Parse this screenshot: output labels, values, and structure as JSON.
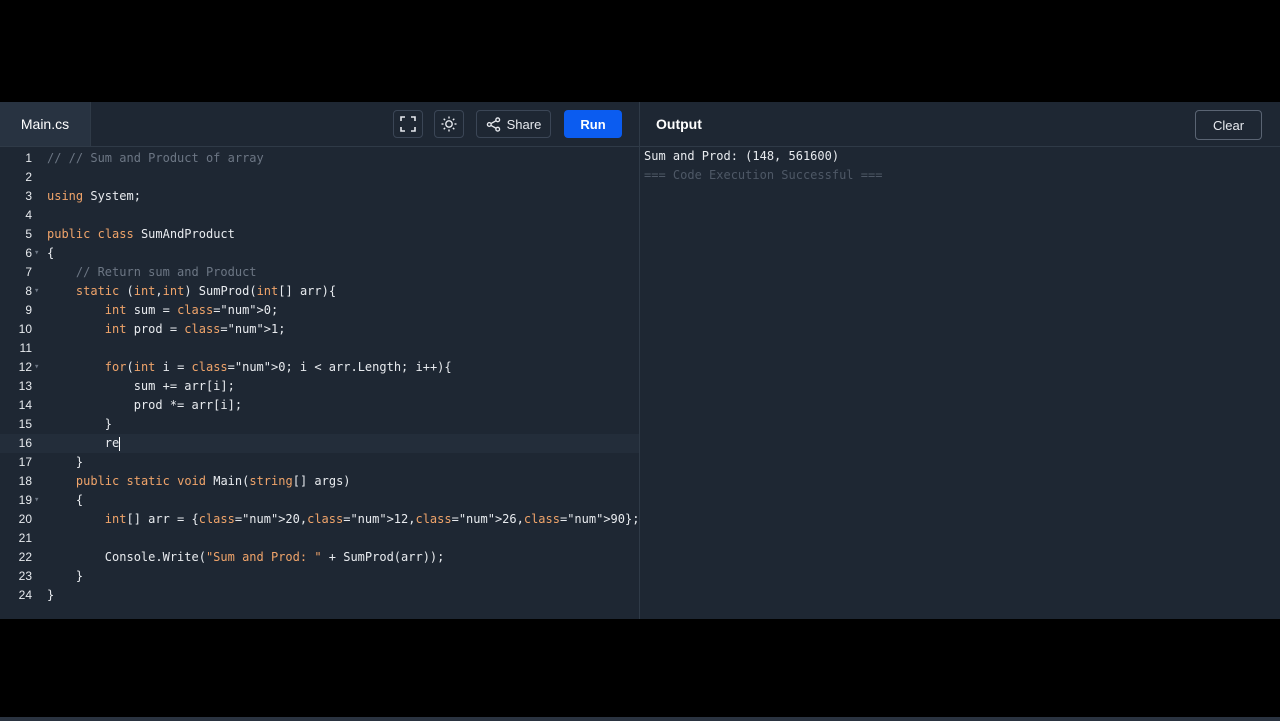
{
  "editor": {
    "file_tab": "Main.cs",
    "share_label": "Share",
    "run_label": "Run",
    "icons": [
      "fullscreen-icon",
      "theme-icon",
      "share-icon"
    ]
  },
  "output": {
    "title": "Output",
    "clear_label": "Clear",
    "lines": [
      "Sum and Prod: (148, 561600)",
      "=== Code Execution Successful ==="
    ]
  },
  "code": {
    "lines": [
      {
        "n": "1",
        "text": "// // Sum and Product of array"
      },
      {
        "n": "2",
        "text": ""
      },
      {
        "n": "3",
        "text": "using System;"
      },
      {
        "n": "4",
        "text": ""
      },
      {
        "n": "5",
        "text": "public class SumAndProduct"
      },
      {
        "n": "6",
        "text": "{"
      },
      {
        "n": "7",
        "text": "    // Return sum and Product"
      },
      {
        "n": "8",
        "text": "    static (int,int) SumProd(int[] arr){"
      },
      {
        "n": "9",
        "text": "        int sum = 0;"
      },
      {
        "n": "10",
        "text": "        int prod = 1;"
      },
      {
        "n": "11",
        "text": ""
      },
      {
        "n": "12",
        "text": "        for(int i = 0; i < arr.Length; i++){"
      },
      {
        "n": "13",
        "text": "            sum += arr[i];"
      },
      {
        "n": "14",
        "text": "            prod *= arr[i];"
      },
      {
        "n": "15",
        "text": "        }"
      },
      {
        "n": "16",
        "text": "        re"
      },
      {
        "n": "17",
        "text": "    }"
      },
      {
        "n": "18",
        "text": "    public static void Main(string[] args)"
      },
      {
        "n": "19",
        "text": "    {"
      },
      {
        "n": "20",
        "text": "        int[] arr = {20,12,26,90};"
      },
      {
        "n": "21",
        "text": ""
      },
      {
        "n": "22",
        "text": "        Console.Write(\"Sum and Prod: \" + SumProd(arr));"
      },
      {
        "n": "23",
        "text": "    }"
      },
      {
        "n": "24",
        "text": "}"
      }
    ]
  }
}
